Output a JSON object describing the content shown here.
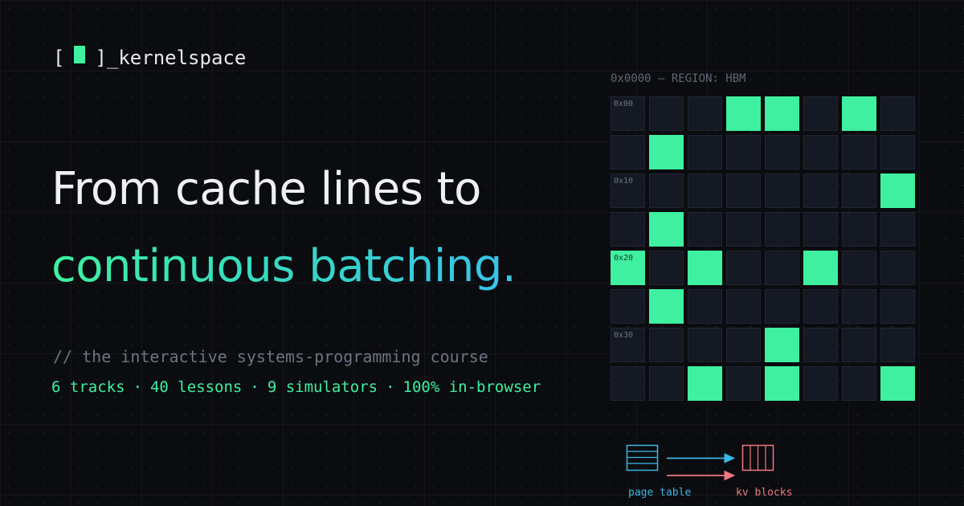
{
  "brand": {
    "bracket_open": "[",
    "bracket_close": "]",
    "name": "_kernelspace",
    "accent": "#3ef0a0"
  },
  "headline": {
    "line1": "From cache lines to",
    "line2": "continuous batching."
  },
  "tagline": "// the interactive systems-programming course",
  "stats": {
    "items": [
      "6 tracks",
      "40 lessons",
      "9 simulators",
      "100% in-browser"
    ],
    "separator": "·"
  },
  "memory_map": {
    "header": "0x0000 — REGION: HBM",
    "columns": 8,
    "row_addresses": [
      "0x00",
      "",
      "0x10",
      "",
      "0x20",
      "",
      "0x30",
      ""
    ],
    "rows": [
      [
        0,
        0,
        0,
        1,
        1,
        0,
        1,
        0
      ],
      [
        0,
        1,
        0,
        0,
        0,
        0,
        0,
        0
      ],
      [
        0,
        0,
        0,
        0,
        0,
        0,
        0,
        1
      ],
      [
        0,
        1,
        0,
        0,
        0,
        0,
        0,
        0
      ],
      [
        1,
        0,
        1,
        0,
        0,
        1,
        0,
        0
      ],
      [
        0,
        1,
        0,
        0,
        0,
        0,
        0,
        0
      ],
      [
        0,
        0,
        0,
        0,
        1,
        0,
        0,
        0
      ],
      [
        0,
        0,
        1,
        0,
        1,
        0,
        0,
        1
      ]
    ],
    "colors": {
      "allocated": "#3ef0a0",
      "free": "#141923"
    }
  },
  "diagram": {
    "page_table_label": "page table",
    "kv_blocks_label": "kv blocks",
    "page_table_color": "#3ab8e6",
    "kv_blocks_color": "#f07882",
    "page_table_icon": "table-icon",
    "kv_blocks_icon": "blocks-icon"
  }
}
